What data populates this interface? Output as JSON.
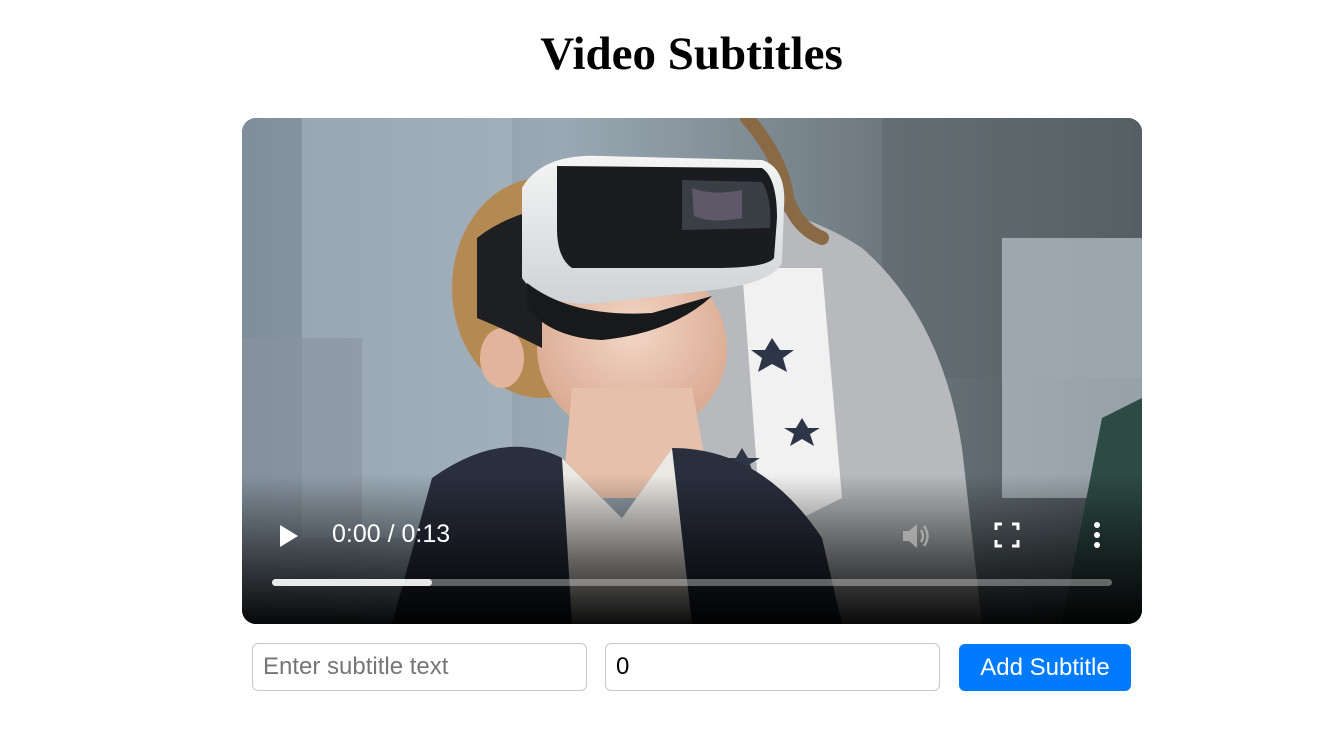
{
  "page": {
    "title": "Video Subtitles"
  },
  "video": {
    "current_time": "0:00",
    "duration": "0:13",
    "time_display": "0:00 / 0:13",
    "buffered_fraction": 0.19,
    "muted_appearance": "dimmed",
    "scene_description_icon": "video-frame"
  },
  "controls": {
    "play_icon": "play-icon",
    "volume_icon": "volume-icon",
    "fullscreen_icon": "fullscreen-icon",
    "more_icon": "more-vertical-icon"
  },
  "form": {
    "subtitle_placeholder": "Enter subtitle text",
    "subtitle_value": "",
    "time_value": "0",
    "add_label": "Add Subtitle"
  },
  "colors": {
    "accent": "#007bff",
    "button_text": "#ffffff",
    "input_border": "#c8c8c8"
  }
}
